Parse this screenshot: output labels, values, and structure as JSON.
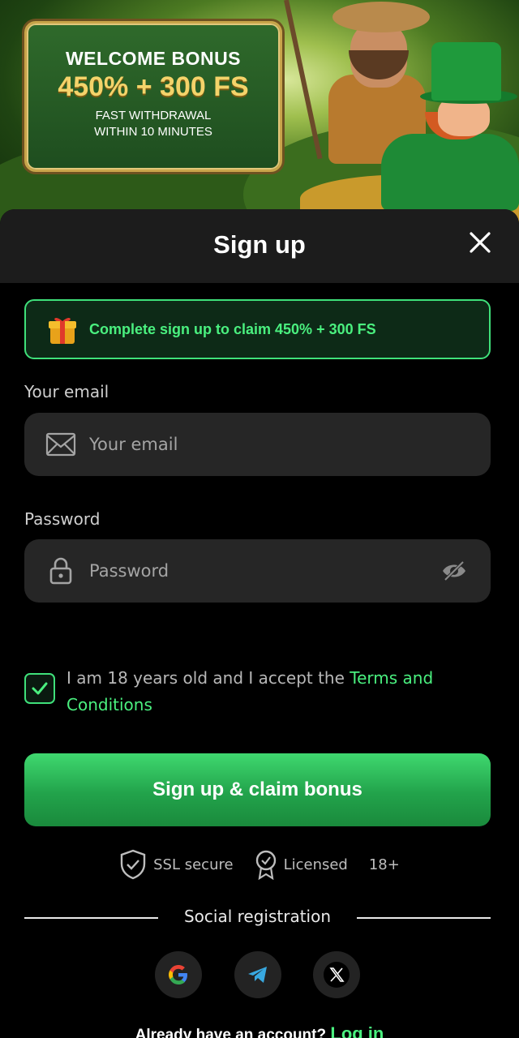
{
  "banner": {
    "title": "WELCOME BONUS",
    "amount": "450% + 300 FS",
    "line1": "FAST WITHDRAWAL",
    "line2": "WITHIN 10 MINUTES"
  },
  "modal": {
    "title": "Sign up",
    "close_icon": "close-icon"
  },
  "promo": {
    "icon": "gift-icon",
    "text": "Complete sign up to claim 450% + 300 FS"
  },
  "email": {
    "label": "Your email",
    "placeholder": "Your email",
    "icon": "mail-icon"
  },
  "password": {
    "label": "Password",
    "placeholder": "Password",
    "icon": "lock-icon",
    "toggle_icon": "eye-off-icon"
  },
  "consent": {
    "checked": true,
    "text": "I am 18 years old and I accept the ",
    "link": "Terms and Conditions"
  },
  "cta": {
    "label": "Sign up & claim bonus"
  },
  "trust": {
    "ssl": "SSL secure",
    "licensed": "Licensed",
    "age": "18+"
  },
  "social": {
    "heading": "Social registration",
    "providers": [
      "google",
      "telegram",
      "x"
    ]
  },
  "footer": {
    "prompt": "Already have an account?",
    "login": "Log in"
  },
  "colors": {
    "accent": "#4af07f",
    "button": "#22a34b",
    "field_bg": "#262626",
    "header_bg": "#1c1c1c"
  }
}
